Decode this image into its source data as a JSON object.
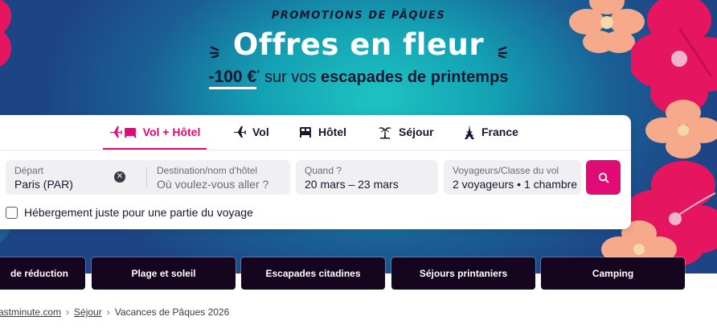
{
  "hero": {
    "promo_tag": "PROMOTIONS DE PÂQUES",
    "title": "Offres en fleur",
    "subtitle": {
      "amount": "-100 €",
      "star": "*",
      "middle": " sur vos ",
      "bold": "escapades de printemps"
    }
  },
  "tabs": [
    {
      "label": "Vol + Hôtel",
      "icon": "plane-bed-icon",
      "active": true
    },
    {
      "label": "Vol",
      "icon": "plane-icon",
      "active": false
    },
    {
      "label": "Hôtel",
      "icon": "bed-icon",
      "active": false
    },
    {
      "label": "Séjour",
      "icon": "palm-tree-icon",
      "active": false
    },
    {
      "label": "France",
      "icon": "eiffel-tower-icon",
      "active": false
    }
  ],
  "search": {
    "departure": {
      "label": "Départ",
      "value": "Paris (PAR)"
    },
    "destination": {
      "label": "Destination/nom d'hôtel",
      "placeholder": "Où voulez-vous aller ?"
    },
    "dates": {
      "label": "Quand ?",
      "value": "20 mars – 23 mars"
    },
    "travelers": {
      "label": "Voyageurs/Classe du vol",
      "value": "2 voyageurs • 1 chambre"
    },
    "search_icon": "search-icon",
    "partial_stay_label": "Hébergement juste pour une partie du voyage"
  },
  "categories": [
    "de réduction",
    "Plage et soleil",
    "Escapades citadines",
    "Séjours printaniers",
    "Camping"
  ],
  "breadcrumb": [
    {
      "label": "astminute.com",
      "link": true
    },
    {
      "label": "Séjour",
      "link": true
    },
    {
      "label": "Vacances de Pâques 2026",
      "link": false
    }
  ],
  "colors": {
    "accent": "#e00b74",
    "dark": "#16051e",
    "flower_pink": "#e5155f",
    "flower_peach": "#f7a98b"
  }
}
